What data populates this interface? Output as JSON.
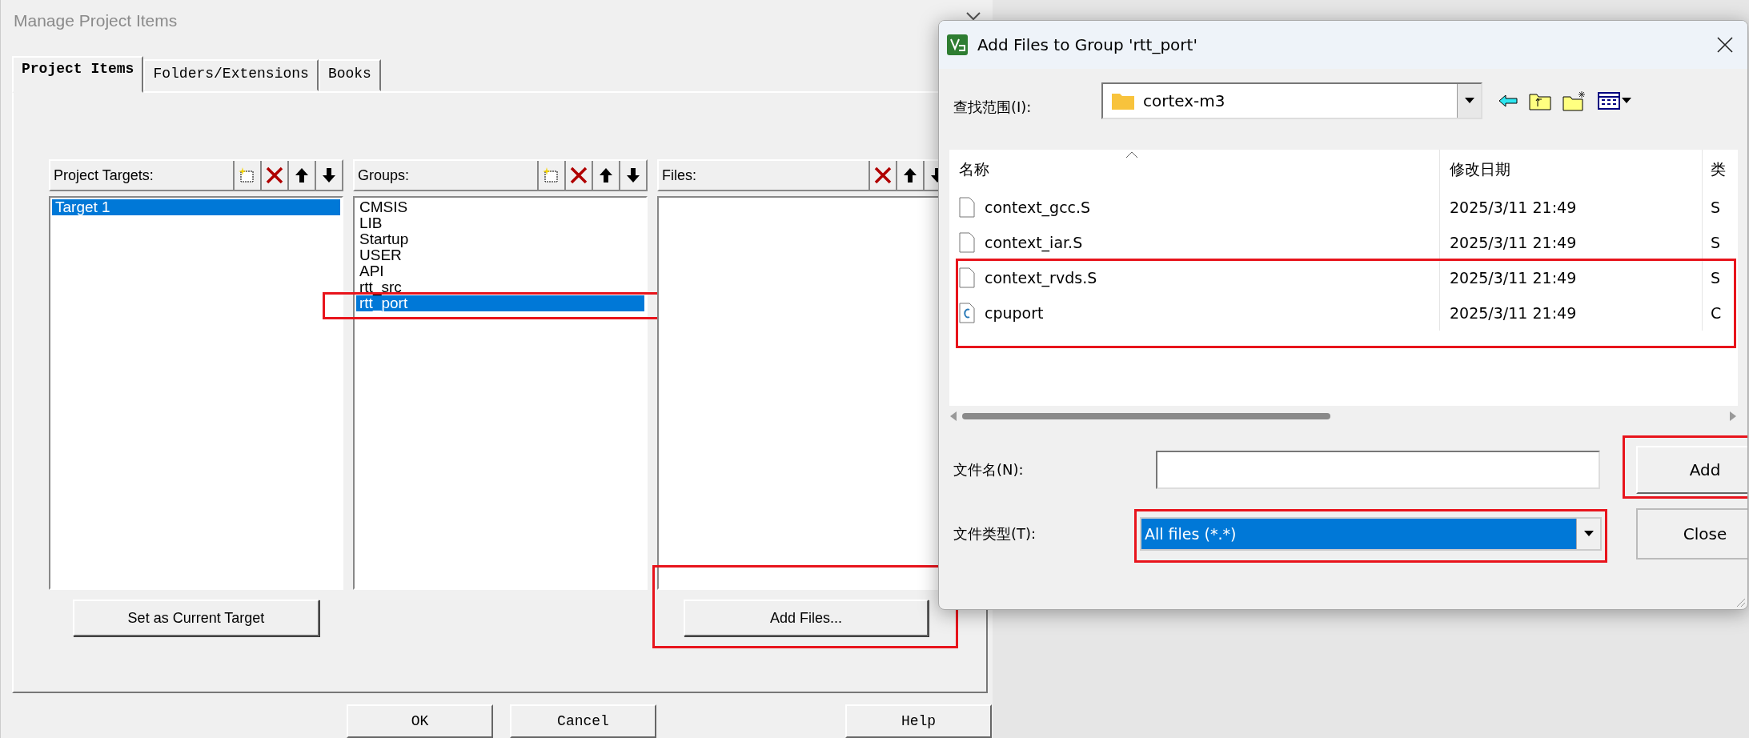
{
  "window": {
    "title": "Manage Project Items"
  },
  "tabs": [
    {
      "label": "Project Items",
      "selected": true
    },
    {
      "label": "Folders/Extensions",
      "selected": false
    },
    {
      "label": "Books",
      "selected": false
    }
  ],
  "panels": [
    {
      "label": "Project Targets:",
      "kind": "editable",
      "items": [
        {
          "name": "Target 1",
          "selected": true,
          "highlighted": false
        }
      ]
    },
    {
      "label": "Groups:",
      "kind": "editable",
      "items": [
        {
          "name": "CMSIS",
          "selected": false,
          "highlighted": false
        },
        {
          "name": "LIB",
          "selected": false,
          "highlighted": false
        },
        {
          "name": "Startup",
          "selected": false,
          "highlighted": false
        },
        {
          "name": "USER",
          "selected": false,
          "highlighted": false
        },
        {
          "name": "API",
          "selected": false,
          "highlighted": false
        },
        {
          "name": "rtt_src",
          "selected": false,
          "highlighted": false
        },
        {
          "name": "rtt_port",
          "selected": true,
          "highlighted": true
        }
      ]
    },
    {
      "label": "Files:",
      "kind": "files"
    }
  ],
  "panel_buttons": [
    {
      "label": "Set as Current Target",
      "highlighted": false
    },
    {
      "label": "Add Files...",
      "highlighted": true
    }
  ],
  "dialog_buttons": [
    "OK",
    "Cancel",
    "Help"
  ],
  "add_dialog": {
    "title": "Add Files to Group 'rtt_port'",
    "look_in_label": "查找范围(I):",
    "look_in": "cortex-m3",
    "columns": [
      "名称",
      "修改日期",
      "类"
    ],
    "rows": [
      {
        "name": "context_gcc.S",
        "date": "2025/3/11 21:49",
        "type": "S",
        "kind": "file",
        "highlighted": false
      },
      {
        "name": "context_iar.S",
        "date": "2025/3/11 21:49",
        "type": "S",
        "kind": "file",
        "highlighted": false
      },
      {
        "name": "context_rvds.S",
        "date": "2025/3/11 21:49",
        "type": "S",
        "kind": "file",
        "highlighted": true
      },
      {
        "name": "cpuport",
        "date": "2025/3/11 21:49",
        "type": "C",
        "kind": "c-source",
        "highlighted": true
      }
    ],
    "filename_label": "文件名(N):",
    "filetype_label": "文件类型(T):",
    "filetype": {
      "value": "All files (*.*)",
      "highlighted": true
    },
    "add_button": {
      "label": "Add",
      "highlighted": true
    },
    "close_button": {
      "label": "Close"
    }
  }
}
